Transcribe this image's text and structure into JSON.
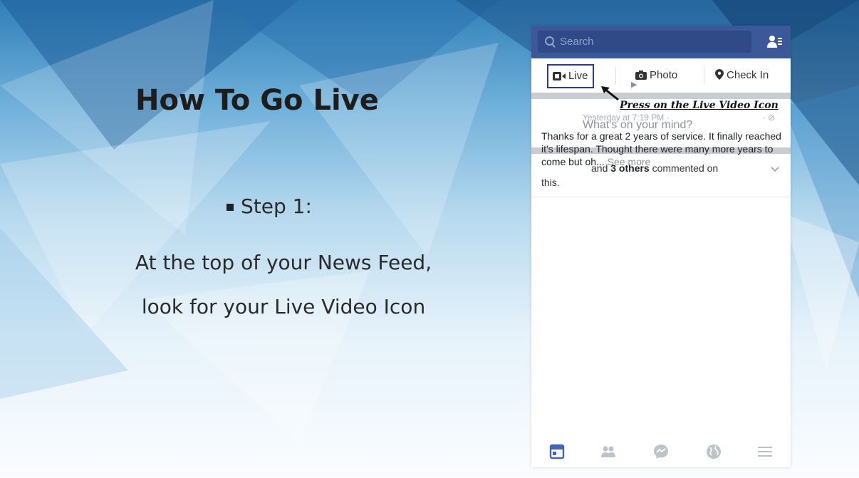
{
  "slide": {
    "title": "How To Go Live",
    "step_label": "Step 1:",
    "description": "At the top of your News Feed, look for your Live Video Icon"
  },
  "phone": {
    "search_placeholder": "Search",
    "actions": {
      "live": "Live",
      "photo": "Photo",
      "check_in": "Check In"
    },
    "callout": "Press on the Live Video Icon",
    "compose_placeholder": "What's on your mind?",
    "story": {
      "pre": "and",
      "count_bold": "3 others",
      "post": "commented on",
      "line2": "this."
    },
    "post": {
      "timestamp": "Yesterday at 7:19 PM ·",
      "privacy": "· ⊘",
      "text": "Thanks for a great 2 years of service. It finally reached it's lifespan. Thought there were many more years to come but oh...",
      "see_more": "See more"
    },
    "tabs": [
      "news-feed",
      "friends",
      "messenger",
      "notifications",
      "menu"
    ]
  },
  "colors": {
    "facebook_blue": "#3b5998",
    "live_border": "#2d3a8c",
    "tab_active": "#4267b2",
    "tab_inactive": "#bec3c9"
  }
}
